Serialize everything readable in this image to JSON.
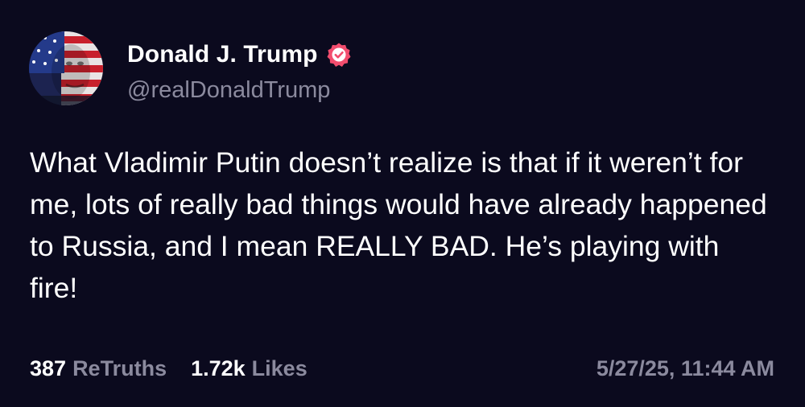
{
  "author": {
    "display_name": "Donald J. Trump",
    "handle": "@realDonaldTrump",
    "verified": true,
    "verified_badge_color": "#f24d6e"
  },
  "post": {
    "text": "What Vladimir Putin doesn’t realize is that if it weren’t for me, lots of really bad things would have already happened to Russia, and I mean REALLY BAD. He’s playing with fire!"
  },
  "stats": {
    "retruths_count": "387",
    "retruths_label": "ReTruths",
    "likes_count": "1.72k",
    "likes_label": "Likes"
  },
  "timestamp": "5/27/25, 11:44 AM",
  "colors": {
    "background": "#0b0a1e",
    "primary_text": "#ffffff",
    "secondary_text": "#8b8a9e"
  }
}
